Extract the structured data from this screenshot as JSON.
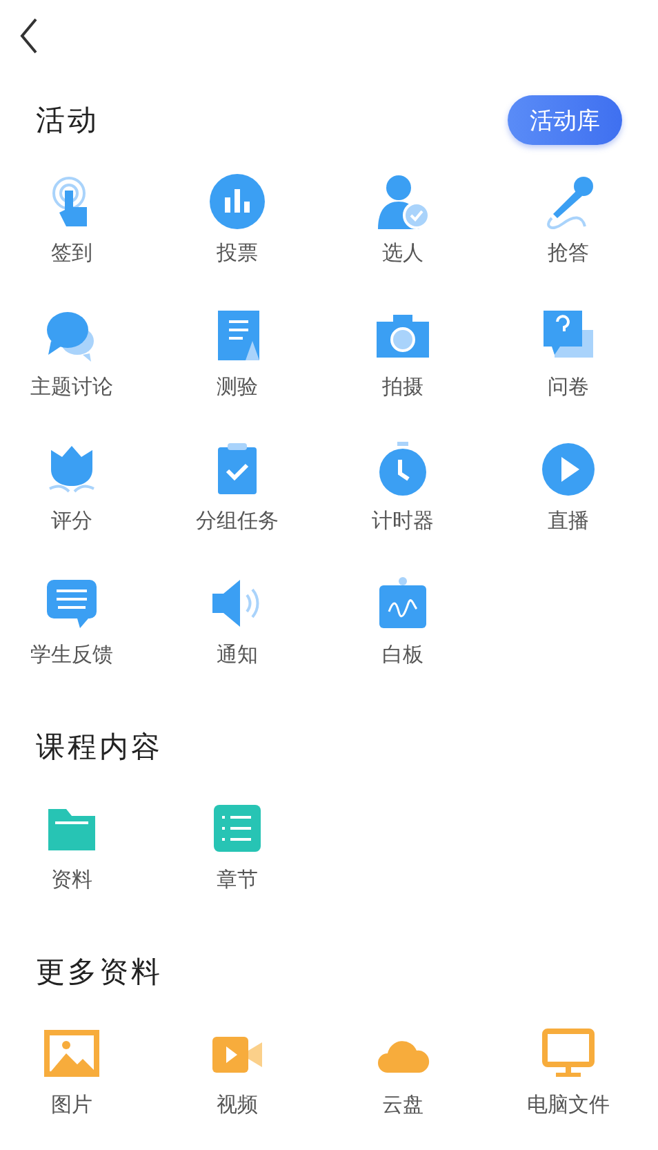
{
  "sections": [
    {
      "title": "活动",
      "action": "活动库",
      "items": [
        "签到",
        "投票",
        "选人",
        "抢答",
        "主题讨论",
        "测验",
        "拍摄",
        "问卷",
        "评分",
        "分组任务",
        "计时器",
        "直播",
        "学生反馈",
        "通知",
        "白板"
      ]
    },
    {
      "title": "课程内容",
      "items": [
        "资料",
        "章节"
      ]
    },
    {
      "title": "更多资料",
      "items": [
        "图片",
        "视频",
        "云盘",
        "电脑文件"
      ]
    }
  ]
}
